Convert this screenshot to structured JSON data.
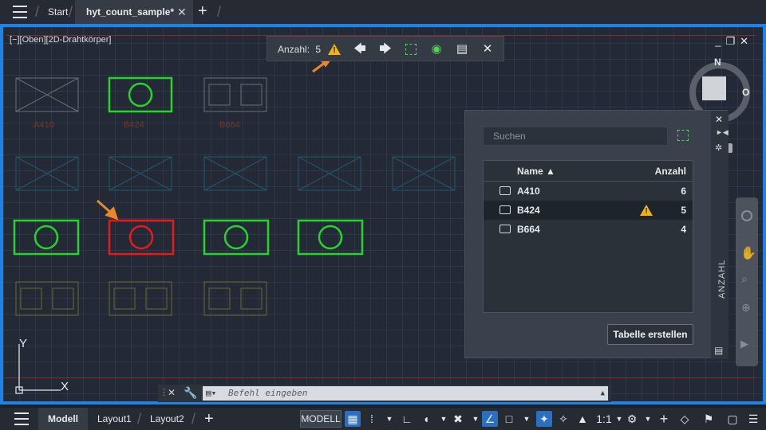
{
  "tabs": {
    "start": "Start",
    "file": "hyt_count_sample*",
    "close": "✕",
    "add": "+"
  },
  "viewport": {
    "label": "[−][Oben][2D-Drahtkörper]",
    "controls": "_❐✕"
  },
  "count_toolbar": {
    "label": "Anzahl:",
    "value": "5"
  },
  "blocks": {
    "row1": [
      "A410",
      "B424",
      "B664"
    ]
  },
  "compass": {
    "north": "N",
    "east": "O"
  },
  "ucs": {
    "x": "X",
    "y": "Y"
  },
  "count_panel": {
    "search_placeholder": "Suchen",
    "col_name": "Name ▲",
    "col_count": "Anzahl",
    "rows": [
      {
        "name": "A410",
        "count": "6"
      },
      {
        "name": "B424",
        "count": "5"
      },
      {
        "name": "B664",
        "count": "4"
      }
    ],
    "create_table": "Tabelle erstellen",
    "side_title": "ANZAHL"
  },
  "cmdline": {
    "placeholder": "Befehl eingeben"
  },
  "statusbar": {
    "model_tab": "Modell",
    "layout1": "Layout1",
    "layout2": "Layout2",
    "model_btn": "MODELL",
    "scale": "1:1"
  },
  "colors": {
    "accent": "#1e82e6",
    "selected_green": "#27d42b",
    "error_red": "#e8191c",
    "warning": "#f4b400",
    "arrow": "#e8882a"
  }
}
